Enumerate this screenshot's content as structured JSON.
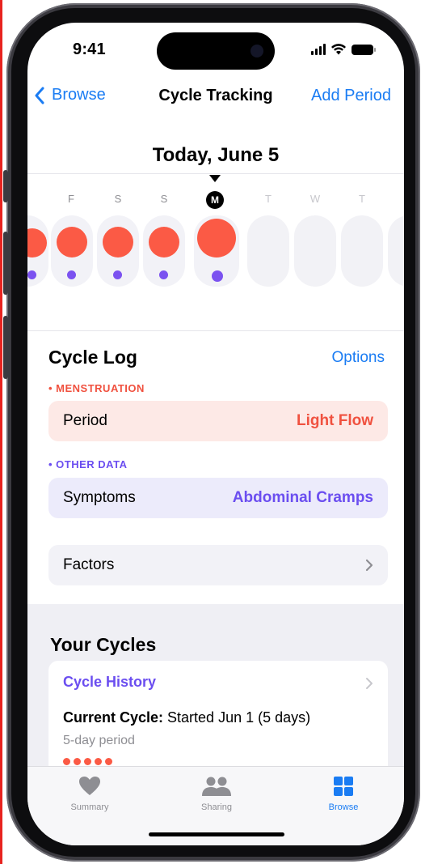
{
  "status_bar": {
    "time": "9:41"
  },
  "nav": {
    "back_label": "Browse",
    "title": "Cycle Tracking",
    "action_label": "Add Period"
  },
  "calendar": {
    "date_title": "Today, June 5",
    "today_letter": "M",
    "days": [
      {
        "letter": "",
        "period": true,
        "symptom": true
      },
      {
        "letter": "F",
        "period": true,
        "symptom": true
      },
      {
        "letter": "S",
        "period": true,
        "symptom": true
      },
      {
        "letter": "S",
        "period": true,
        "symptom": true
      },
      {
        "letter": "M",
        "period": true,
        "symptom": true,
        "today": true
      },
      {
        "letter": "T",
        "period": false,
        "symptom": false
      },
      {
        "letter": "W",
        "period": false,
        "symptom": false
      },
      {
        "letter": "T",
        "period": false,
        "symptom": false
      }
    ]
  },
  "cycle_log": {
    "title": "Cycle Log",
    "options_label": "Options",
    "menstruation_tag": "• MENSTRUATION",
    "period_label": "Period",
    "period_value": "Light Flow",
    "other_data_tag": "• OTHER DATA",
    "symptoms_label": "Symptoms",
    "symptoms_value": "Abdominal Cramps",
    "factors_label": "Factors"
  },
  "your_cycles": {
    "title": "Your Cycles",
    "history_label": "Cycle History",
    "current_cycle_label": "Current Cycle:",
    "current_cycle_value": " Started Jun 1 (5 days)",
    "period_length": "5-day period",
    "period_days_count": 5
  },
  "tabbar": {
    "tabs": [
      {
        "label": "Summary",
        "icon": "heart-icon",
        "active": false
      },
      {
        "label": "Sharing",
        "icon": "people-icon",
        "active": false
      },
      {
        "label": "Browse",
        "icon": "grid-icon",
        "active": true
      }
    ]
  },
  "colors": {
    "accent": "#1a7cf3",
    "period": "#fb5a45",
    "symptom": "#7b52f0"
  }
}
